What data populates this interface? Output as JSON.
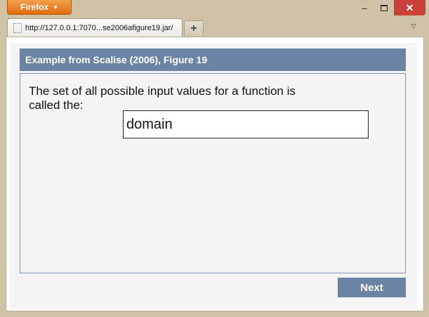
{
  "browser": {
    "menu_label": "Firefox",
    "menu_caret": "▼",
    "window_controls": {
      "minimize": "–",
      "close": "✕"
    },
    "tab": {
      "title": "http://127.0.0.1:7070...se2006afigure19.jar/"
    },
    "new_tab_label": "+",
    "tab_list_label": "▽"
  },
  "app": {
    "header": "Example from Scalise (2006), Figure 19",
    "question": "The set of all possible input values for a function is called the:",
    "answer_value": "domain",
    "next_label": "Next"
  },
  "colors": {
    "header_bg": "#6b84a3",
    "panel_border": "#7b92b0",
    "chrome": "#cfc2a6",
    "close_button": "#c9423a",
    "firefox_button": "#e06b10"
  },
  "icons": [
    "page-icon",
    "caret-down-icon",
    "minimize-icon",
    "maximize-icon",
    "close-icon",
    "plus-icon",
    "tab-list-icon"
  ]
}
